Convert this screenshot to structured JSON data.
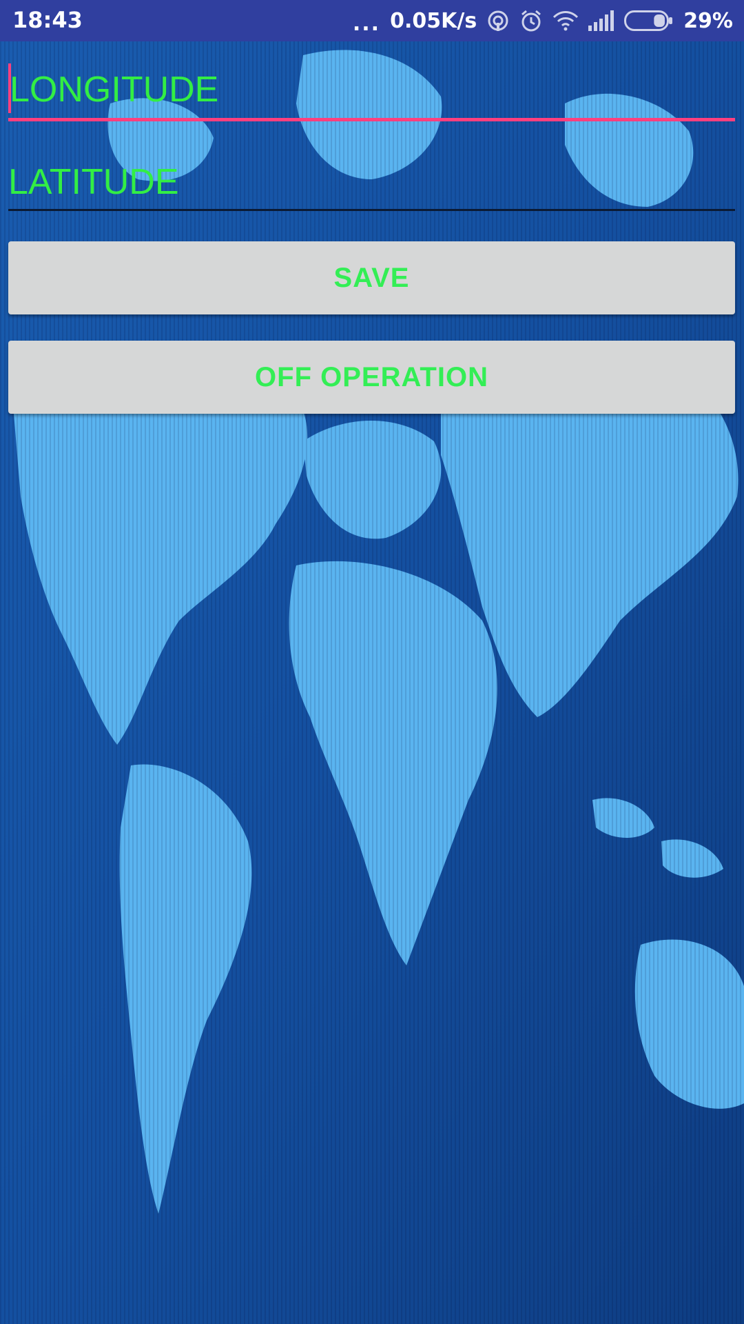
{
  "status_bar": {
    "time": "18:43",
    "dots": "...",
    "net_speed": "0.05K/s",
    "battery_pct": "29%",
    "battery_level": 0.29,
    "icons": [
      "hotspot-icon",
      "alarm-icon",
      "wifi-icon",
      "signal-icon",
      "battery-icon"
    ]
  },
  "form": {
    "longitude": {
      "placeholder": "LONGITUDE",
      "value": ""
    },
    "latitude": {
      "placeholder": "LATITUDE",
      "value": ""
    }
  },
  "buttons": {
    "save_label": "SAVE",
    "off_label": "OFF OPERATION"
  },
  "colors": {
    "status_bar": "#303f9f",
    "accent": "#ff3f7e",
    "text_green": "#33ee44",
    "button_bg": "#d6d7d7",
    "map_land": "#5ab4f0",
    "map_ocean": "#1450a0"
  }
}
